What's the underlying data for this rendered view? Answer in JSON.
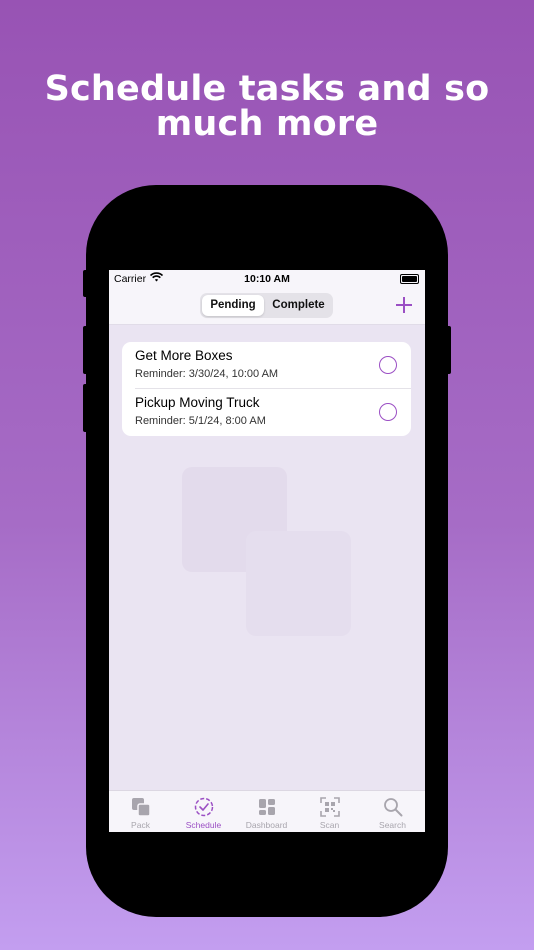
{
  "headline": {
    "line1": "Schedule tasks and so",
    "line2": "much more"
  },
  "status_bar": {
    "carrier": "Carrier",
    "time": "10:10 AM",
    "icons": [
      "wifi-icon",
      "battery-icon"
    ]
  },
  "nav": {
    "segments": [
      "Pending",
      "Complete"
    ],
    "selected_segment": "Pending",
    "add_icon": "plus-icon"
  },
  "tasks": [
    {
      "title": "Get More Boxes",
      "reminder": "Reminder: 3/30/24, 10:00 AM",
      "completed": false
    },
    {
      "title": "Pickup Moving Truck",
      "reminder": "Reminder: 5/1/24, 8:00 AM",
      "completed": false
    }
  ],
  "tab_bar": {
    "tabs": [
      {
        "label": "Pack",
        "icon": "boxes-icon"
      },
      {
        "label": "Schedule",
        "icon": "clock-check-icon"
      },
      {
        "label": "Dashboard",
        "icon": "grid-icon"
      },
      {
        "label": "Scan",
        "icon": "qr-scan-icon"
      },
      {
        "label": "Search",
        "icon": "search-icon"
      }
    ],
    "active": "Schedule"
  },
  "colors": {
    "accent": "#9b4fc4",
    "background_top": "#9853b4",
    "background_bottom": "#c39ef0",
    "inactive_tab": "#a8a5ad"
  }
}
